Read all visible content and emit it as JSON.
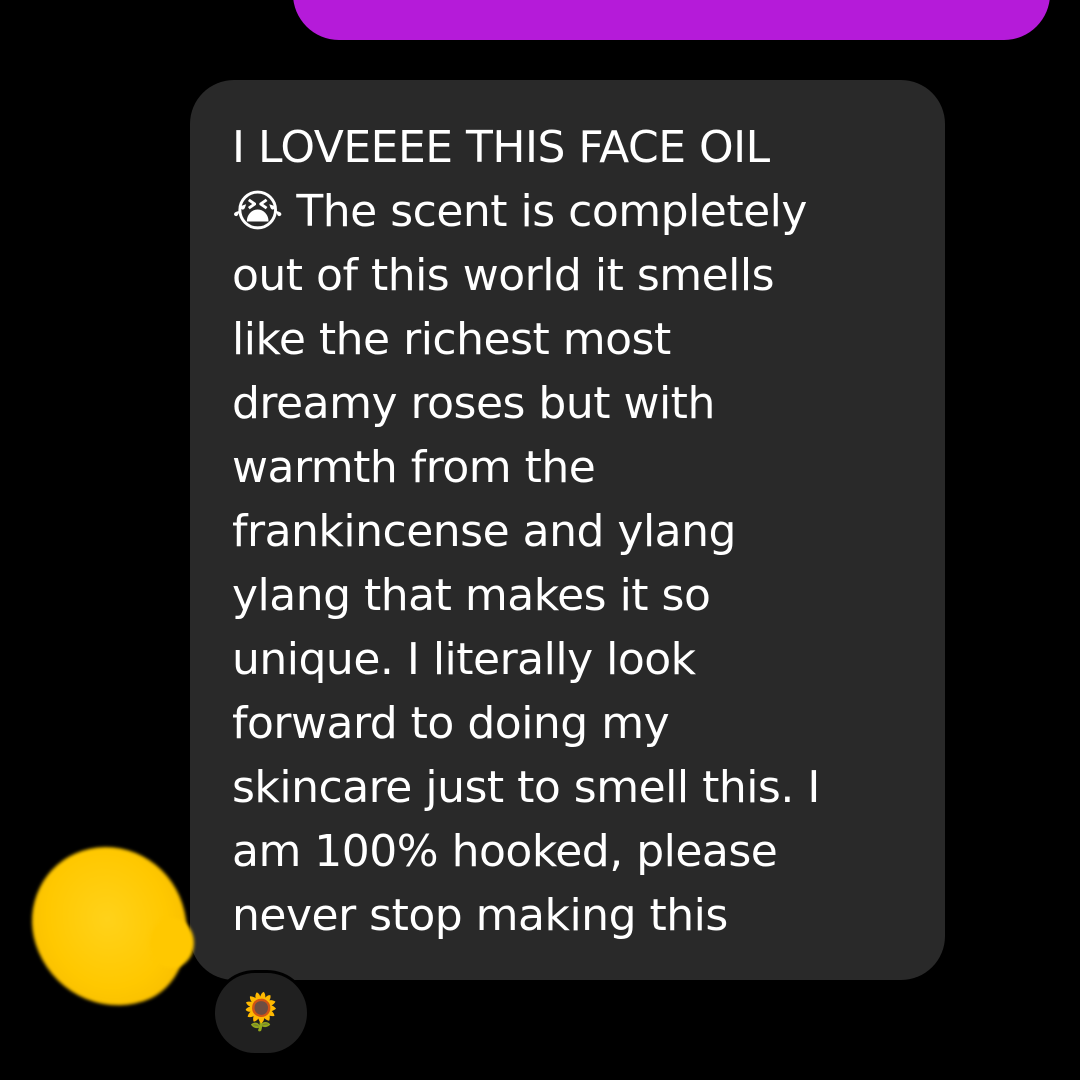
{
  "sent_message": {
    "color": "#b51bd9"
  },
  "received_message": {
    "text": "I LOVEEEE THIS FACE OIL\n😭 The scent is completely\nout of this world it smells\nlike the richest most\ndreamy roses but with\nwarmth from the\nfrankincense and ylang\nylang that makes it so\nunique. I literally look\nforward to doing my\nskincare just to smell this. I\nam 100% hooked, please\nnever stop making this",
    "bubble_color": "#292929"
  },
  "avatar": {
    "color": "#ffc800"
  },
  "reaction": {
    "emoji": "🌻"
  }
}
